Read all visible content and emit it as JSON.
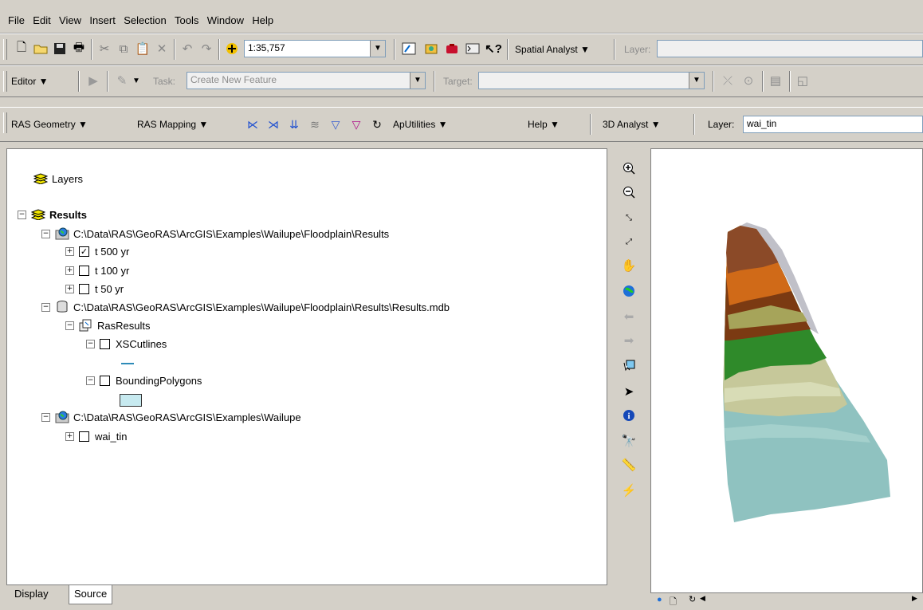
{
  "menu": [
    "File",
    "Edit",
    "View",
    "Insert",
    "Selection",
    "Tools",
    "Window",
    "Help"
  ],
  "standard_toolbar": {
    "scale_value": "1:35,757",
    "spatial_analyst_label": "Spatial Analyst ▼",
    "layer_label": "Layer:"
  },
  "editor_toolbar": {
    "editor_label": "Editor ▼",
    "task_label": "Task:",
    "task_value": "Create New Feature",
    "target_label": "Target:"
  },
  "ras_toolbar": {
    "ras_geometry": "RAS Geometry ▼",
    "ras_mapping": "RAS Mapping ▼",
    "aputilities": "ApUtilities ▼",
    "help": "Help ▼",
    "analyst_3d": "3D Analyst ▼",
    "layer_label": "Layer:",
    "layer_value": "wai_tin"
  },
  "toc": {
    "layers_label": "Layers",
    "results_label": "Results",
    "ws1_path": "C:\\Data\\RAS\\GeoRAS\\ArcGIS\\Examples\\Wailupe\\Floodplain\\Results",
    "t500": "t 500 yr",
    "t100": "t 100 yr",
    "t50": "t 50 yr",
    "mdb_path": "C:\\Data\\RAS\\GeoRAS\\ArcGIS\\Examples\\Wailupe\\Floodplain\\Results\\Results.mdb",
    "rasresults": "RasResults",
    "xscutlines": "XSCutlines",
    "bounding": "BoundingPolygons",
    "ws2_path": "C:\\Data\\RAS\\GeoRAS\\ArcGIS\\Examples\\Wailupe",
    "wai_tin": "wai_tin"
  },
  "tabs": {
    "display": "Display",
    "source": "Source"
  },
  "colors": {
    "window_bg": "#d4d0c8",
    "xs_line": "#2e8bb8",
    "bounding_fill": "#c7eaf0"
  }
}
